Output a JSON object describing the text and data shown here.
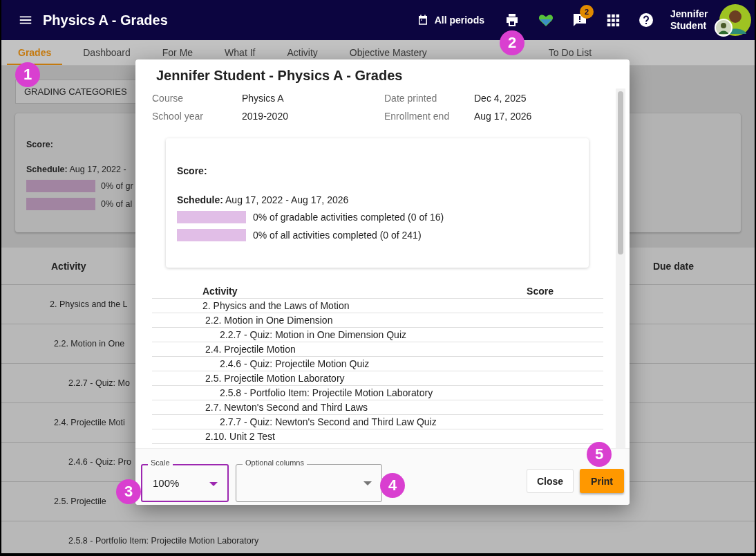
{
  "header": {
    "title": "Physics A - Grades",
    "period": "All periods",
    "print_callout": "2",
    "notifications": "2",
    "user": "Jennifer Student"
  },
  "tabs": [
    {
      "label": "Grades",
      "selected": true,
      "callout": "1"
    },
    {
      "label": "Dashboard",
      "selected": false
    },
    {
      "label": "For Me",
      "selected": false
    },
    {
      "label": "What If",
      "selected": false
    },
    {
      "label": "Activity",
      "selected": false
    },
    {
      "label": "Objective Mastery",
      "selected": false
    },
    {
      "label": "To Do List",
      "selected": false
    }
  ],
  "grading_categories_button": "GRADING CATEGORIES",
  "summary": {
    "score_label": "Score:",
    "schedule_label": "Schedule:",
    "schedule": "Aug 17, 2022 -",
    "progress": [
      {
        "level": 0,
        "text": "0% of gr"
      },
      {
        "level": 0,
        "text": "0% of al"
      }
    ]
  },
  "table": {
    "columns": [
      "Activity",
      "Due date"
    ],
    "rows": [
      "2. Physics and the L",
      "2.2. Motion in One",
      "2.2.7 - Quiz: Mo",
      "2.4. Projectile Moti",
      "2.4.6 - Quiz: Pro",
      "2.5. Projectile",
      "2.5.8 - Portfolio Item: Projectile Motion Laboratory"
    ]
  },
  "dialog": {
    "title": "Jennifer Student - Physics A - Grades",
    "info": [
      {
        "label": "Course",
        "value": "Physics A"
      },
      {
        "label": "Date printed",
        "value": "Dec 4, 2025"
      },
      {
        "label": "School year",
        "value": "2019-2020"
      },
      {
        "label": "Enrollment end",
        "value": "Aug 17, 2026"
      }
    ],
    "summary": {
      "score_label": "Score:",
      "schedule_label": "Schedule:",
      "schedule": "Aug 17, 2022 - Aug 17, 2026",
      "progress": [
        {
          "level": 0,
          "text": "0% of gradable activities completed (0 of 16)"
        },
        {
          "level": 0,
          "text": "0% of all activities completed (0 of 241)"
        }
      ]
    },
    "table": {
      "columns": [
        "Activity",
        "Score"
      ],
      "rows": [
        {
          "activity": "2. Physics and the Laws of Motion",
          "children": [
            {
              "activity": "2.2. Motion in One Dimension",
              "children": [
                {
                  "activity": "2.2.7 - Quiz: Motion in One Dimension Quiz"
                }
              ]
            },
            {
              "activity": "2.4. Projectile Motion",
              "children": [
                {
                  "activity": "2.4.6 - Quiz: Projectile Motion Quiz"
                }
              ]
            },
            {
              "activity": "2.5. Projectile Motion Laboratory",
              "children": [
                {
                  "activity": "2.5.8 - Portfolio Item: Projectile Motion Laboratory"
                }
              ]
            },
            {
              "activity": "2.7. Newton's Second and Third Laws",
              "children": [
                {
                  "activity": "2.7.7 - Quiz: Newton's Second and Third Law Quiz"
                }
              ]
            },
            {
              "activity": "2.10. Unit 2 Test"
            }
          ]
        }
      ]
    },
    "scale": {
      "label": "Scale",
      "value": "100%",
      "focused": true,
      "callout": "3"
    },
    "optional_columns": {
      "label": "Optional columns",
      "callout": "4"
    },
    "buttons": [
      {
        "label": "Close",
        "kind": "secondary"
      },
      {
        "label": "Print",
        "kind": "primary",
        "callout": "5"
      }
    ]
  }
}
